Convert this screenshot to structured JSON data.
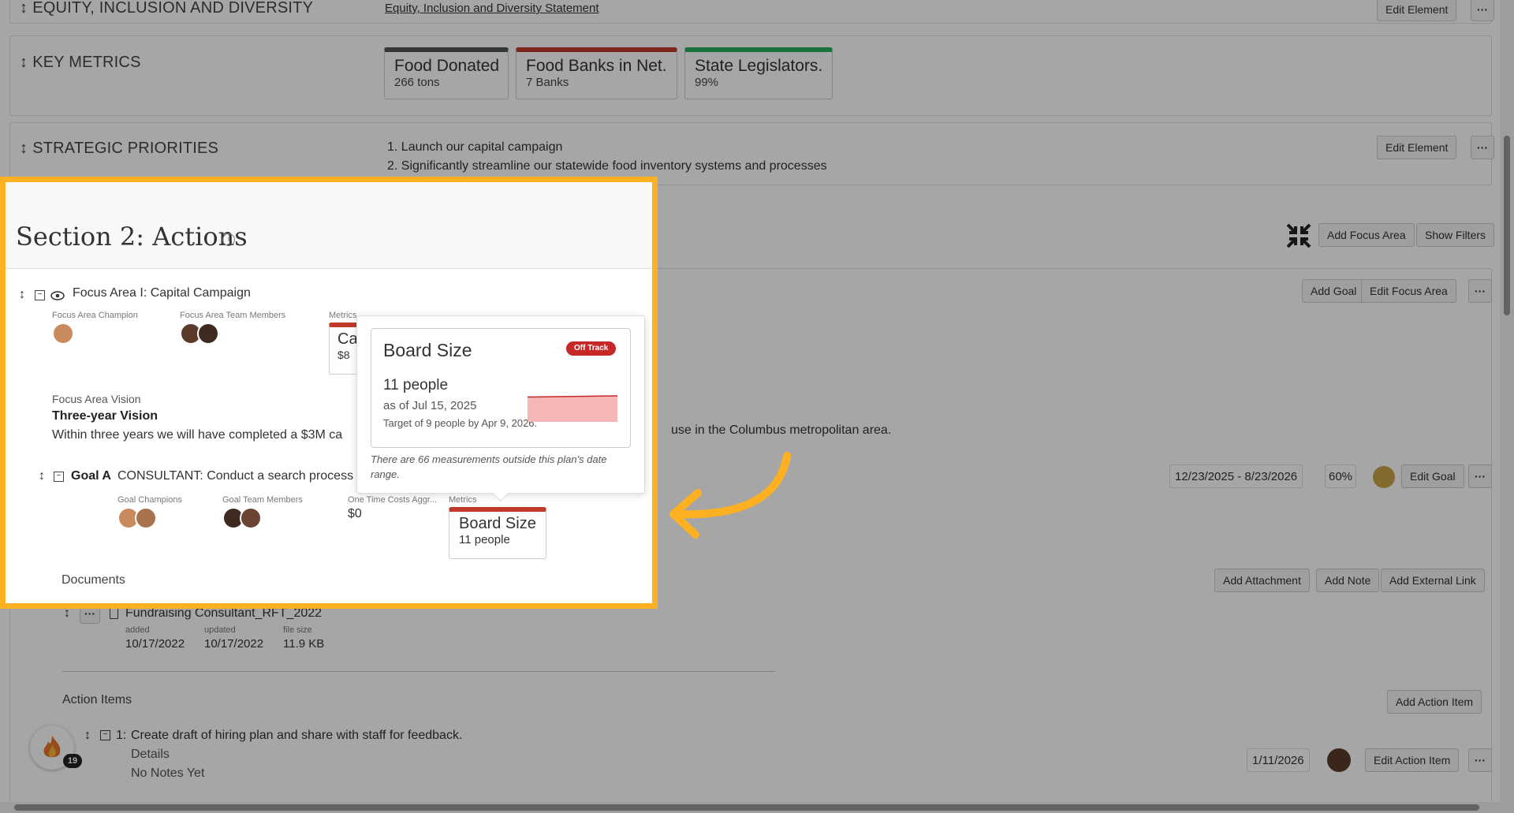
{
  "sections": {
    "equity": {
      "title": "EQUITY, INCLUSION AND DIVERSITY",
      "link": "Equity, Inclusion and Diversity Statement"
    },
    "key_metrics": {
      "title": "KEY METRICS",
      "tiles": [
        {
          "title": "Food Donated",
          "value": "266 tons",
          "color": "#555555"
        },
        {
          "title": "Food Banks in Net...",
          "value": "7 Banks",
          "color": "#C0392B"
        },
        {
          "title": "State Legislators...",
          "value": "99%",
          "color": "#27AE60"
        }
      ]
    },
    "priorities": {
      "title": "STRATEGIC PRIORITIES",
      "items": [
        "1. Launch our capital campaign",
        "2. Significantly streamline our statewide food inventory systems and processes"
      ]
    }
  },
  "buttons": {
    "edit_element": "Edit Element",
    "more": "···",
    "add_focus_area": "Add Focus Area",
    "show_filters": "Show Filters",
    "add_goal": "Add Goal",
    "edit_focus_area": "Edit Focus Area",
    "edit_goal": "Edit Goal",
    "add_attachment": "Add Attachment",
    "add_note": "Add Note",
    "add_external_link": "Add External Link",
    "add_action_item": "Add Action Item",
    "edit_action_item": "Edit Action Item"
  },
  "actions": {
    "section_title": "Section 2: Actions",
    "focus_area": {
      "title": "Focus Area I: Capital Campaign",
      "champion_label": "Focus Area Champion",
      "team_label": "Focus Area Team Members",
      "metrics_label": "Metrics",
      "metric_tile_title": "Ca",
      "metric_tile_value": "$8",
      "vision_label": "Focus Area Vision",
      "vision_title": "Three-year Vision",
      "vision_text_left": "Within three years we will have completed a $3M ca",
      "vision_text_right": "use in the Columbus metropolitan area."
    },
    "goal": {
      "label": "Goal A",
      "text": "CONSULTANT: Conduct a search process",
      "champions_label": "Goal Champions",
      "team_label": "Goal Team Members",
      "costs_label": "One Time Costs Aggr...",
      "costs_value": "$0",
      "metrics_label": "Metrics",
      "metric_title": "Board Size",
      "metric_value": "11 people",
      "date_range": "12/23/2025 - 8/23/2026",
      "percent": "60%",
      "status_color": "#C9A54A"
    },
    "documents": {
      "title": "Documents",
      "file_name": "Fundraising Consultant_RFT_2022",
      "added_label": "added",
      "added": "10/17/2022",
      "updated_label": "updated",
      "updated": "10/17/2022",
      "size_label": "file size",
      "size": "11.9 KB"
    },
    "action_items": {
      "title": "Action Items",
      "item_index": "1:",
      "item_text": "Create draft of hiring plan and share with staff for feedback.",
      "details": "Details",
      "notes": "No Notes Yet",
      "date": "1/11/2026",
      "badge_count": "19"
    }
  },
  "popup": {
    "title": "Board Size",
    "status": "Off Track",
    "status_color": "#C62828",
    "value": "11 people",
    "as_of": "as of Jul 15, 2025",
    "target": "Target of 9 people by Apr 9, 2026.",
    "note": "There are 66 measurements outside this plan's date range.",
    "chart": {
      "line_values": [
        0.75,
        0.9
      ],
      "fill_color": "#F4B6B6",
      "line_color": "#C62828"
    }
  },
  "accent": "#FDB022"
}
